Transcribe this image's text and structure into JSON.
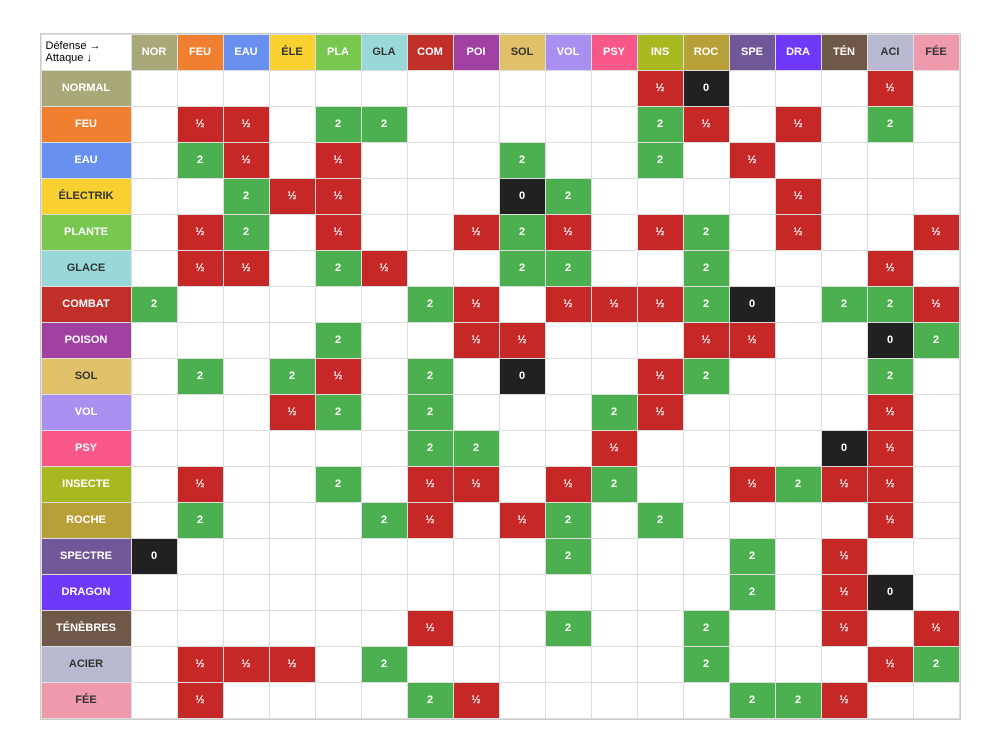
{
  "corner": {
    "line1": "Défense →",
    "line2": "Attaque ↓"
  },
  "col_headers": [
    {
      "key": "NOR",
      "label": "NOR",
      "cls": "type-NOR"
    },
    {
      "key": "FEU",
      "label": "FEU",
      "cls": "type-FEU"
    },
    {
      "key": "EAU",
      "label": "EAU",
      "cls": "type-EAU"
    },
    {
      "key": "ELE",
      "label": "ÉLE",
      "cls": "type-ELE"
    },
    {
      "key": "PLA",
      "label": "PLA",
      "cls": "type-PLA"
    },
    {
      "key": "GLA",
      "label": "GLA",
      "cls": "type-GLA"
    },
    {
      "key": "COM",
      "label": "COM",
      "cls": "type-COM"
    },
    {
      "key": "POI",
      "label": "POI",
      "cls": "type-POI"
    },
    {
      "key": "SOL",
      "label": "SOL",
      "cls": "type-SOL"
    },
    {
      "key": "VOL",
      "label": "VOL",
      "cls": "type-VOL"
    },
    {
      "key": "PSY",
      "label": "PSY",
      "cls": "type-PSY"
    },
    {
      "key": "INS",
      "label": "INS",
      "cls": "type-INS"
    },
    {
      "key": "ROC",
      "label": "ROC",
      "cls": "type-ROC"
    },
    {
      "key": "SPE",
      "label": "SPE",
      "cls": "type-SPE"
    },
    {
      "key": "DRA",
      "label": "DRA",
      "cls": "type-DRA"
    },
    {
      "key": "TEN",
      "label": "TÉN",
      "cls": "type-TEN"
    },
    {
      "key": "ACI",
      "label": "ACI",
      "cls": "type-ACI"
    },
    {
      "key": "FEE",
      "label": "FÉE",
      "cls": "type-FEE"
    }
  ],
  "rows": [
    {
      "label": "NORMAL",
      "cls": "type-NOR",
      "cells": [
        "",
        "",
        "",
        "",
        "",
        "",
        "",
        "",
        "",
        "",
        "",
        "½",
        "0",
        "",
        "",
        "",
        "½",
        ""
      ]
    },
    {
      "label": "FEU",
      "cls": "type-FEU",
      "cells": [
        "",
        "½",
        "½",
        "",
        "2",
        "2",
        "",
        "",
        "",
        "",
        "",
        "2",
        "½",
        "",
        "½",
        "",
        "2",
        ""
      ]
    },
    {
      "label": "EAU",
      "cls": "type-EAU",
      "cells": [
        "",
        "2",
        "½",
        "",
        "½",
        "",
        "",
        "",
        "2",
        "",
        "",
        "2",
        "",
        "½",
        "",
        "",
        "",
        ""
      ]
    },
    {
      "label": "ÉLECTRIK",
      "cls": "type-ELE",
      "cells": [
        "",
        "",
        "2",
        "½",
        "½",
        "",
        "",
        "",
        "0",
        "2",
        "",
        "",
        "",
        "",
        "½",
        "",
        "",
        ""
      ]
    },
    {
      "label": "PLANTE",
      "cls": "type-PLA",
      "cells": [
        "",
        "½",
        "2",
        "",
        "½",
        "",
        "",
        "½",
        "2",
        "½",
        "",
        "½",
        "2",
        "",
        "½",
        "",
        "",
        "½"
      ]
    },
    {
      "label": "GLACE",
      "cls": "type-GLA",
      "cells": [
        "",
        "½",
        "½",
        "",
        "2",
        "½",
        "",
        "",
        "2",
        "2",
        "",
        "",
        "2",
        "",
        "",
        "",
        "½",
        ""
      ]
    },
    {
      "label": "COMBAT",
      "cls": "type-COM",
      "cells": [
        "2",
        "",
        "",
        "",
        "",
        "",
        "2",
        "½",
        "",
        "½",
        "½",
        "½",
        "2",
        "0",
        "",
        "2",
        "2",
        "½"
      ]
    },
    {
      "label": "POISON",
      "cls": "type-POI",
      "cells": [
        "",
        "",
        "",
        "",
        "2",
        "",
        "",
        "½",
        "½",
        "",
        "",
        "",
        "½",
        "½",
        "",
        "",
        "0",
        "2"
      ]
    },
    {
      "label": "SOL",
      "cls": "type-SOL",
      "cells": [
        "",
        "2",
        "",
        "2",
        "½",
        "",
        "2",
        "",
        "0",
        "",
        "",
        "½",
        "2",
        "",
        "",
        "",
        "2",
        ""
      ]
    },
    {
      "label": "VOL",
      "cls": "type-VOL",
      "cells": [
        "",
        "",
        "",
        "½",
        "2",
        "",
        "2",
        "",
        "",
        "",
        "2",
        "½",
        "",
        "",
        "",
        "",
        "½",
        ""
      ]
    },
    {
      "label": "PSY",
      "cls": "type-PSY",
      "cells": [
        "",
        "",
        "",
        "",
        "",
        "",
        "2",
        "2",
        "",
        "",
        "½",
        "",
        "",
        "",
        "",
        "0",
        "½",
        ""
      ]
    },
    {
      "label": "INSECTE",
      "cls": "type-INS",
      "cells": [
        "",
        "½",
        "",
        "",
        "2",
        "",
        "½",
        "½",
        "",
        "½",
        "2",
        "",
        "",
        "½",
        "2",
        "½",
        "½",
        ""
      ]
    },
    {
      "label": "ROCHE",
      "cls": "type-ROC",
      "cells": [
        "",
        "2",
        "",
        "",
        "",
        "2",
        "½",
        "",
        "½",
        "2",
        "",
        "2",
        "",
        "",
        "",
        "",
        "½",
        ""
      ]
    },
    {
      "label": "SPECTRE",
      "cls": "type-SPE",
      "cells": [
        "0",
        "",
        "",
        "",
        "",
        "",
        "",
        "",
        "",
        "2",
        "",
        "",
        "",
        "2",
        "",
        "½",
        "",
        ""
      ]
    },
    {
      "label": "DRAGON",
      "cls": "type-DRA",
      "cells": [
        "",
        "",
        "",
        "",
        "",
        "",
        "",
        "",
        "",
        "",
        "",
        "",
        "",
        "2",
        "",
        "½",
        "0",
        ""
      ]
    },
    {
      "label": "TÉNÈBRES",
      "cls": "type-TEN",
      "cells": [
        "",
        "",
        "",
        "",
        "",
        "",
        "½",
        "",
        "",
        "2",
        "",
        "",
        "2",
        "",
        "",
        "½",
        "",
        "½"
      ]
    },
    {
      "label": "ACIER",
      "cls": "type-ACI",
      "cells": [
        "",
        "½",
        "½",
        "½",
        "",
        "2",
        "",
        "",
        "",
        "",
        "",
        "",
        "2",
        "",
        "",
        "",
        "½",
        "2"
      ]
    },
    {
      "label": "FÉE",
      "cls": "type-FEE",
      "cells": [
        "",
        "½",
        "",
        "",
        "",
        "",
        "2",
        "½",
        "",
        "",
        "",
        "",
        "",
        "2",
        "2",
        "½",
        "",
        ""
      ]
    }
  ]
}
